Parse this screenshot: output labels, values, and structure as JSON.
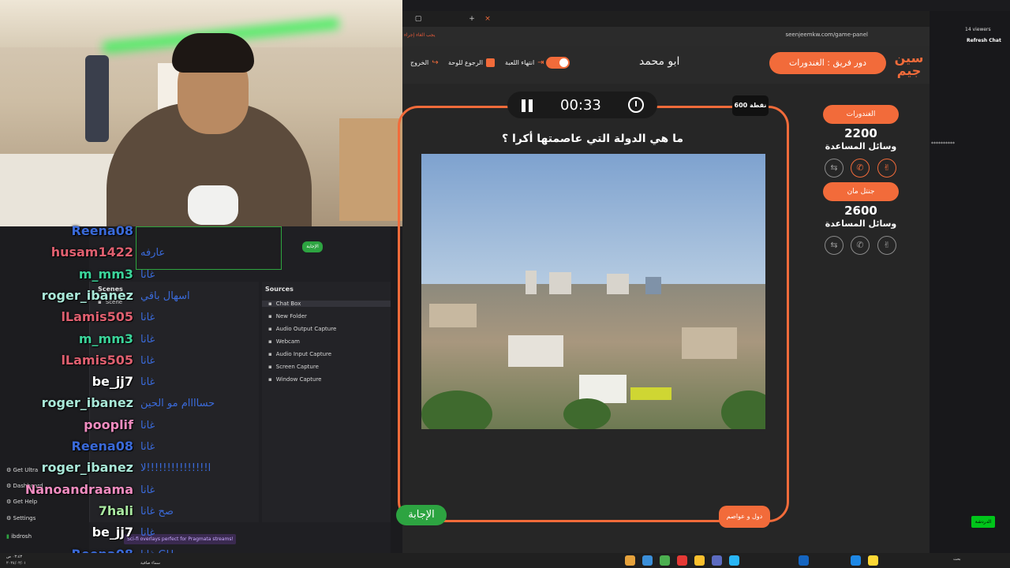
{
  "browser": {
    "url": "seenjeemkw.com/game-panel",
    "bookmark_text": "يجب الغاء إجراء"
  },
  "game": {
    "turn_label": "دور فريق : الغندورات",
    "player_name": "ابو محمد",
    "exit_label": "الخروج",
    "back_label": "الرجوع للوحة",
    "end_label": "انتهاء اللعبة",
    "timer": "00:33",
    "points": "600 نقطة",
    "question": "ما هي الدولة التي عاصمتها أكرا ؟",
    "answer_label": "الإجابة",
    "category": "دول و عواصم"
  },
  "teams": [
    {
      "name": "الغندورات",
      "score": "2200",
      "help_label": "وسائل المساعدة"
    },
    {
      "name": "جنتل مان",
      "score": "2600",
      "help_label": "وسائل المساعدة"
    }
  ],
  "twitch": {
    "viewers": "14 viewers",
    "refresh": "Refresh Chat",
    "send": "الدردشة"
  },
  "chat": [
    {
      "user": "Reena08",
      "msg": "",
      "color": "#3a6ad9"
    },
    {
      "user": "husam1422",
      "msg": "عارفه",
      "color": "#e06070"
    },
    {
      "user": "m_mm3",
      "msg": "غانا",
      "color": "#3bd49a"
    },
    {
      "user": "roger_ibanez",
      "msg": "اسهال باقي",
      "color": "#a9e8d8"
    },
    {
      "user": "lLamis505",
      "msg": "غانا",
      "color": "#e06070"
    },
    {
      "user": "m_mm3",
      "msg": "غانا",
      "color": "#3bd49a"
    },
    {
      "user": "lLamis505",
      "msg": "غانا",
      "color": "#e06070"
    },
    {
      "user": "be_jj7",
      "msg": "غانا",
      "color": "#ffffff"
    },
    {
      "user": "roger_ibanez",
      "msg": "حساااام مو الحين",
      "color": "#a9e8d8"
    },
    {
      "user": "pooplif",
      "msg": "غانا",
      "color": "#f08cc0"
    },
    {
      "user": "Reena08",
      "msg": "غانا",
      "color": "#3a6ad9"
    },
    {
      "user": "roger_ibanez",
      "msg": "ا!!!!!!!!!!!!!!!لا",
      "color": "#a9e8d8"
    },
    {
      "user": "Nanoandraama",
      "msg": "غانا",
      "color": "#f08cc0"
    },
    {
      "user": "7hali",
      "msg": "صح غانا",
      "color": "#a9e8a0"
    },
    {
      "user": "be_jj7",
      "msg": "غانا",
      "color": "#ffffff"
    },
    {
      "user": "Reena08",
      "msg": "غانا GH",
      "color": "#3a6ad9"
    }
  ],
  "studio": {
    "scenes_title": "Scenes",
    "scene_item": "Scene",
    "sources_title": "Sources",
    "sources": [
      "Chat Box",
      "New Folder",
      "Audio Output Capture",
      "Webcam",
      "Audio Input Capture",
      "Screen Capture",
      "Window Capture"
    ],
    "side_menu": [
      "Get Ultra",
      "Dashboard",
      "Get Help",
      "Settings"
    ],
    "user": "ibdrosh",
    "toast": "Sci-fi overlays perfect for Pragmata streams!",
    "answer_mini": "الإجابة"
  },
  "taskbar": {
    "time": "٠٣:٤٣ ص",
    "date": "٢٠٢٤/٠٢/٠١",
    "weather": "سماء صافية",
    "search": "بحث"
  }
}
